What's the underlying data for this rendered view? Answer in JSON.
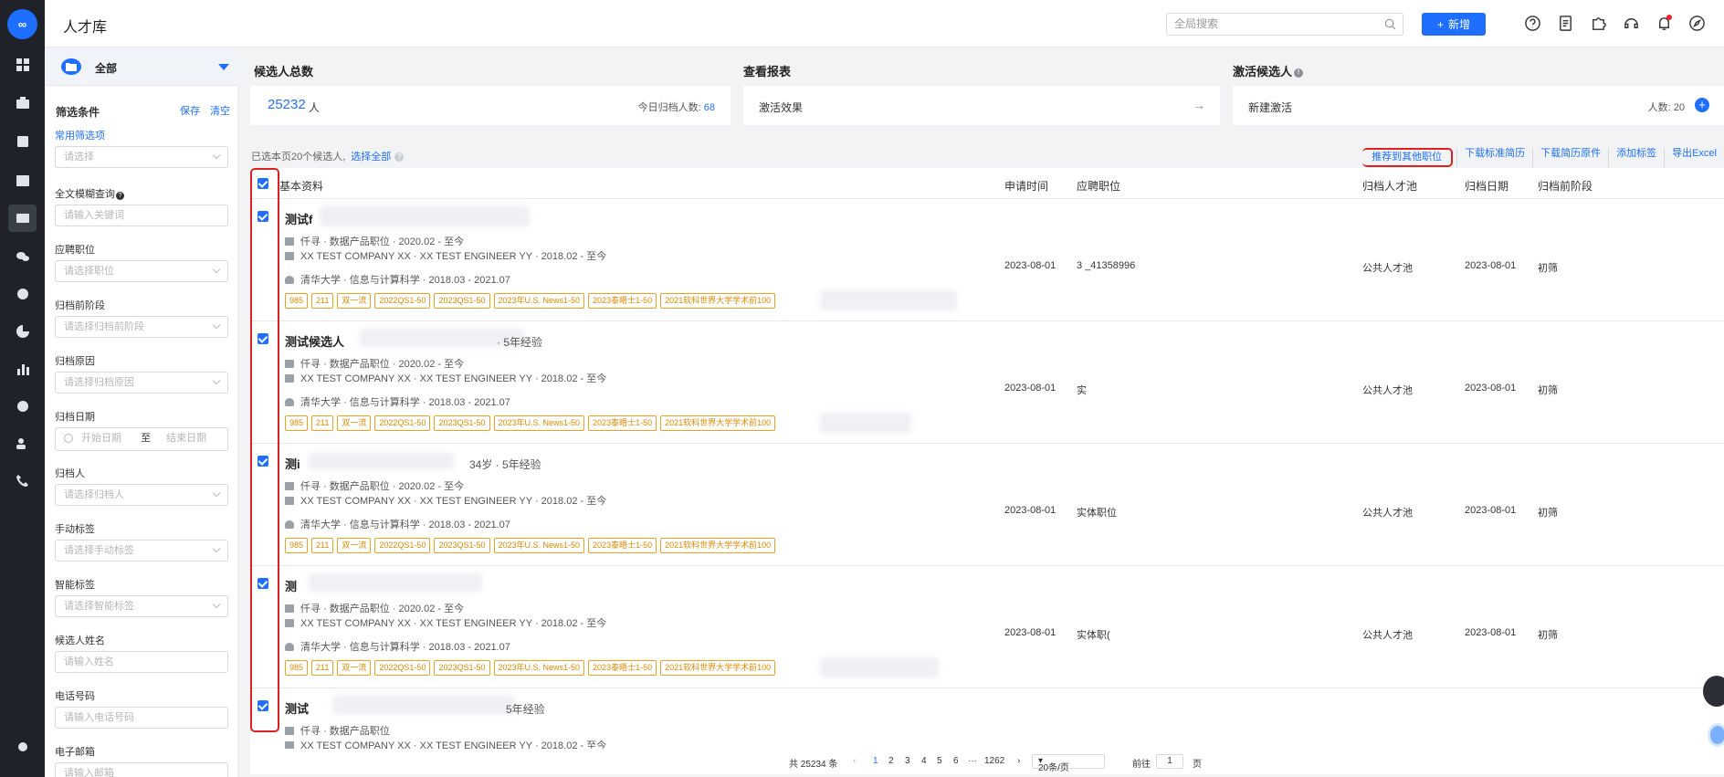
{
  "app": {
    "logo_text": "∞",
    "page_title": "人才库"
  },
  "header": {
    "search_placeholder": "全局搜索",
    "new_button": "新增",
    "new_icon": "+",
    "icons": [
      "help-circle-icon",
      "document-icon",
      "puzzle-icon",
      "headset-icon",
      "bell-icon",
      "compass-icon"
    ]
  },
  "rail_icons": [
    "dashboard-icon",
    "briefcase-icon",
    "resume-icon",
    "calendar-icon",
    "talent-pool-icon",
    "wechat-icon",
    "fire-icon",
    "pie-chart-icon",
    "bar-chart-icon",
    "badge-icon",
    "team-icon",
    "phone-icon",
    "settings-icon"
  ],
  "filter": {
    "folder": "全部",
    "title": "筛选条件",
    "save": "保存",
    "clear": "清空",
    "common_label": "常用筛选项",
    "common_placeholder": "请选择",
    "fields": [
      {
        "label": "全文模糊查询",
        "placeholder": "请输入关键词",
        "has_help": true
      },
      {
        "label": "应聘职位",
        "placeholder": "请选择职位"
      },
      {
        "label": "归档前阶段",
        "placeholder": "请选择归档前阶段"
      },
      {
        "label": "归档原因",
        "placeholder": "请选择归档原因"
      },
      {
        "label": "归档日期",
        "start": "开始日期",
        "to": "至",
        "end": "结束日期"
      },
      {
        "label": "归档人",
        "placeholder": "请选择归档人"
      },
      {
        "label": "手动标签",
        "placeholder": "请选择手动标签"
      },
      {
        "label": "智能标签",
        "placeholder": "请选择智能标签"
      },
      {
        "label": "候选人姓名",
        "placeholder": "请输入姓名"
      },
      {
        "label": "电话号码",
        "placeholder": "请输入电话号码"
      },
      {
        "label": "电子邮箱",
        "placeholder": "请输入邮箱"
      }
    ]
  },
  "stats": {
    "total_label": "候选人总数",
    "total_value": "25232",
    "total_unit": "人",
    "today_label": "今日归档人数:",
    "today_value": "68",
    "report_label": "查看报表",
    "report_card": "激活效果",
    "report_arrow": "→",
    "activate_label": "激活候选人",
    "activate_card": "新建激活",
    "activate_count": "人数: 20",
    "activate_plus": "+"
  },
  "selection": {
    "text": "已选本页20个候选人,",
    "select_all": "选择全部"
  },
  "actions": [
    "推荐到其他职位",
    "下载标准简历",
    "下载简历原件",
    "添加标签",
    "导出Excel"
  ],
  "columns": [
    "基本资料",
    "申请时间",
    "应聘职位",
    "归档人才池",
    "归档日期",
    "归档前阶段"
  ],
  "tags": [
    "985",
    "211",
    "双一流",
    "2022QS1-50",
    "2023QS1-50",
    "2023年U.S. News1-50",
    "2023泰晤士1-50",
    "2021软科世界大学学术前100"
  ],
  "rows": [
    {
      "name": "测试f",
      "meta": "",
      "job_line": "仟寻 · 数据产品职位 · 2020.02 - 至今",
      "company_line": "XX TEST COMPANY XX · XX TEST ENGINEER YY · 2018.02 - 至今",
      "edu_line": "清华大学 · 信息与计算科学 · 2018.03 - 2021.07",
      "apply_date": "2023-08-01",
      "position": "3                    _41358996",
      "pool": "公共人才池",
      "archive_date": "2023-08-01",
      "stage": "初筛"
    },
    {
      "name": "测试候选人",
      "meta": "· 5年经验",
      "job_line": "仟寻 · 数据产品职位 · 2020.02 - 至今",
      "company_line": "XX TEST COMPANY XX · XX TEST ENGINEER YY · 2018.02 - 至今",
      "edu_line": "清华大学 · 信息与计算科学 · 2018.03 - 2021.07",
      "apply_date": "2023-08-01",
      "position": "实",
      "pool": "公共人才池",
      "archive_date": "2023-08-01",
      "stage": "初筛"
    },
    {
      "name": "测i",
      "meta": "34岁 · 5年经验",
      "job_line": "仟寻 · 数据产品职位 · 2020.02 - 至今",
      "company_line": "XX TEST COMPANY XX · XX TEST ENGINEER YY · 2018.02 - 至今",
      "edu_line": "清华大学 · 信息与计算科学 · 2018.03 - 2021.07",
      "apply_date": "2023-08-01",
      "position": "实体职位",
      "pool": "公共人才池",
      "archive_date": "2023-08-01",
      "stage": "初筛"
    },
    {
      "name": "测",
      "meta": "",
      "job_line": "仟寻 · 数据产品职位 · 2020.02 - 至今",
      "company_line": "XX TEST COMPANY XX · XX TEST ENGINEER YY · 2018.02 - 至今",
      "edu_line": "清华大学 · 信息与计算科学 · 2018.03 - 2021.07",
      "apply_date": "2023-08-01",
      "position": "实体职(",
      "pool": "公共人才池",
      "archive_date": "2023-08-01",
      "stage": "初筛"
    },
    {
      "name": "测试",
      "meta": "5年经验",
      "job_line": "仟寻 · 数据产品职位",
      "company_line": "XX TEST COMPANY XX · XX TEST ENGINEER YY · 2018.02 - 至今",
      "edu_line": "",
      "apply_date": "",
      "position": "",
      "pool": "",
      "archive_date": "",
      "stage": ""
    }
  ],
  "pager": {
    "total": "共 25234 条",
    "prev": "‹",
    "pages": [
      "1",
      "2",
      "3",
      "4",
      "5",
      "6"
    ],
    "ellipsis": "···",
    "last": "1262",
    "next": "›",
    "size": "20条/页",
    "goto": "前往",
    "goto_value": "1",
    "page_unit": "页"
  }
}
